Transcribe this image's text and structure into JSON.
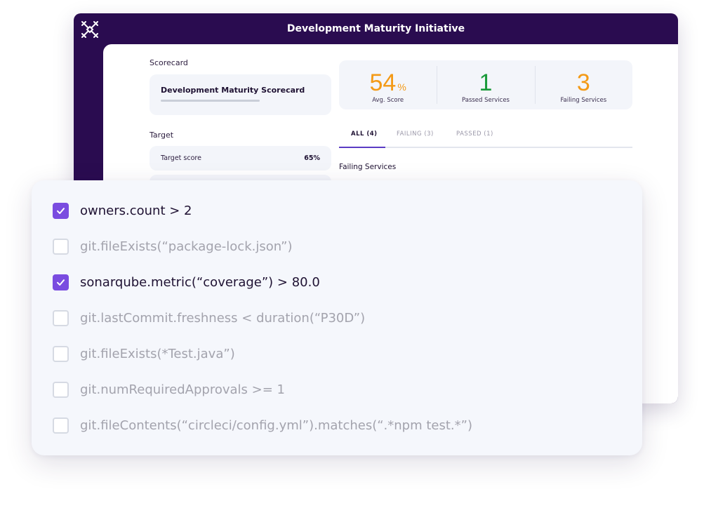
{
  "window": {
    "title": "Development Maturity Initiative",
    "logo_icon": "cortex-logo"
  },
  "left_panel": {
    "scorecard_label": "Scorecard",
    "scorecard_name": "Development Maturity Scorecard",
    "target_label": "Target",
    "target_score_label": "Target score",
    "target_score_value": "65%"
  },
  "stats": {
    "avg_score": {
      "value": "54",
      "suffix": "%",
      "caption": "Avg. Score",
      "color": "#f39a17"
    },
    "passed": {
      "value": "1",
      "caption": "Passed Services",
      "color": "#1a9a3a"
    },
    "failing": {
      "value": "3",
      "caption": "Failing Services",
      "color": "#f39a17"
    }
  },
  "tabs": [
    {
      "label": "ALL (4)",
      "active": true
    },
    {
      "label": "FAILING (3)",
      "active": false
    },
    {
      "label": "PASSED (1)",
      "active": false
    }
  ],
  "failing_services_title": "Failing Services",
  "checklist": [
    {
      "text": "owners.count > 2",
      "checked": true
    },
    {
      "text": "git.fileExists(“package-lock.json”)",
      "checked": false
    },
    {
      "text": "sonarqube.metric(“coverage”) > 80.0",
      "checked": true
    },
    {
      "text": "git.lastCommit.freshness < duration(“P30D”)",
      "checked": false
    },
    {
      "text": "git.fileExists(*Test.java”)",
      "checked": false
    },
    {
      "text": "git.numRequiredApprovals >= 1",
      "checked": false
    },
    {
      "text": "git.fileContents(“circleci/config.yml”).matches(“.*npm test.*”)",
      "checked": false
    }
  ],
  "colors": {
    "accent": "#7a4ce0",
    "window_bg": "#2a0c50"
  }
}
